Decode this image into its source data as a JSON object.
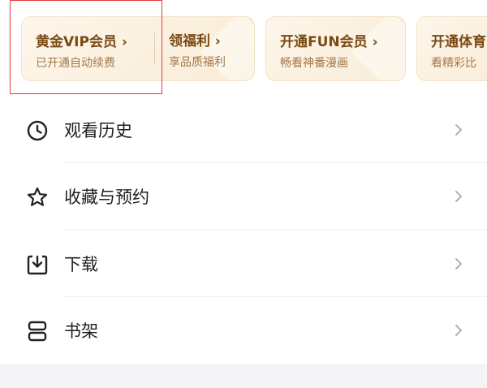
{
  "vip_cards": [
    {
      "title": "黄金VIP会员 ›",
      "subtitle": "已开通自动续费"
    },
    {
      "title": "领福利 ›",
      "subtitle": "享品质福利"
    },
    {
      "title": "开通FUN会员 ›",
      "subtitle": "畅看神番漫画"
    },
    {
      "title": "开通体育",
      "subtitle": "看精彩比"
    }
  ],
  "menu": [
    {
      "label": "观看历史",
      "icon": "clock-icon"
    },
    {
      "label": "收藏与预约",
      "icon": "star-icon"
    },
    {
      "label": "下载",
      "icon": "download-icon"
    },
    {
      "label": "书架",
      "icon": "bookshelf-icon"
    }
  ],
  "colors": {
    "vip_title": "#7a4a14",
    "vip_subtitle": "#a3784a",
    "highlight_box": "#e23b3b",
    "menu_text": "#1f1f1f",
    "chevron": "#b0b0b0"
  }
}
